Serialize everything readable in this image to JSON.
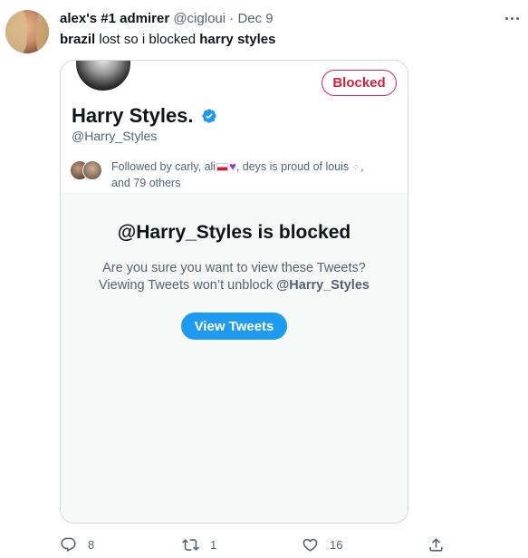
{
  "tweet": {
    "author_name": "alex's #1 admirer",
    "handle": "@cigloui",
    "separator": "·",
    "date": "Dec 9",
    "text_bold_1": "brazil",
    "text_mid": " lost so i blocked ",
    "text_bold_2": "harry styles"
  },
  "embedded": {
    "blocked_label": "Blocked",
    "profile_name": "Harry Styles.",
    "profile_handle": "@Harry_Styles",
    "followed_prefix": "Followed by carly, ali",
    "followed_mid": ", deys is proud of louis",
    "followed_suffix": ",",
    "followed_more": "and 79 others",
    "blocked_title": "@Harry_Styles is blocked",
    "blocked_question": "Are you sure you want to view these Tweets?",
    "blocked_note_prefix": "Viewing Tweets won’t unblock ",
    "blocked_note_handle": "@Harry_Styles",
    "view_button": "View Tweets"
  },
  "actions": {
    "replies": "8",
    "retweets": "1",
    "likes": "16"
  },
  "colors": {
    "accent": "#1d9bf0",
    "blocked_red": "#d81f3c",
    "muted_text": "#536471"
  },
  "icons": [
    "more-icon",
    "verified-icon",
    "reply-icon",
    "retweet-icon",
    "like-icon",
    "share-icon"
  ]
}
